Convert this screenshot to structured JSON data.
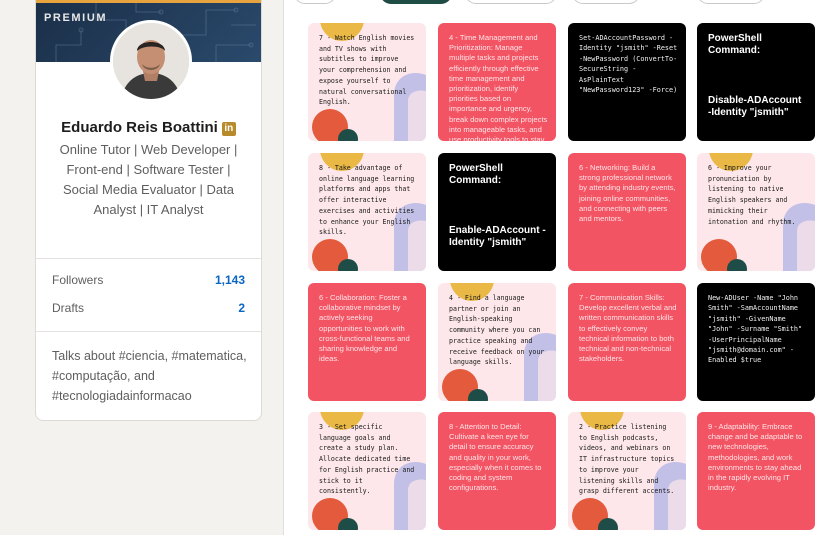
{
  "profile": {
    "badge": "PREMIUM",
    "name": "Eduardo Reis Boattini",
    "linkedin_badge": "in",
    "headline": "Online Tutor | Web Developer | Front-end | Software Tester | Social Media Evaluator | Data Analyst | IT Analyst",
    "stats": {
      "followers_label": "Followers",
      "followers_value": "1,143",
      "drafts_label": "Drafts",
      "drafts_value": "2"
    },
    "talks_about": "Talks about #ciencia, #matematica, #computação, and #tecnologiadainformacao"
  },
  "colors": {
    "accent_link": "#0a66c2",
    "tile_pink": "#fde7ea",
    "tile_red": "#f25464",
    "tile_black": "#000000",
    "deco_yellow": "#e9b845",
    "deco_lavender": "#b7b9e6",
    "deco_teal": "#1e4d47",
    "deco_orange": "#e35a3c"
  },
  "tiles": [
    {
      "style": "pink",
      "text": "7 - Watch English movies and TV shows with subtitles to improve your comprehension and expose yourself to natural conversational English."
    },
    {
      "style": "red",
      "text": "4 - Time Management and Prioritization: Manage multiple tasks and projects efficiently through effective time management and prioritization, identify priorities based on importance and urgency, break down complex projects into manageable tasks, and use productivity tools to stay organized."
    },
    {
      "style": "black-code",
      "text": "Set-ADAccountPassword -Identity \"jsmith\" -Reset -NewPassword (ConvertTo-SecureString -AsPlainText \"NewPassword123\" -Force)"
    },
    {
      "style": "black-ps",
      "title": "PowerShell Command:",
      "cmd": "Disable-ADAccount -Identity \"jsmith\""
    },
    {
      "style": "pink",
      "text": "8 - Take advantage of online language learning platforms and apps that offer interactive exercises and activities to enhance your English skills."
    },
    {
      "style": "black-ps",
      "title": "PowerShell Command:",
      "cmd": "Enable-ADAccount -Identity \"jsmith\""
    },
    {
      "style": "red",
      "text": "6 - Networking: Build a strong professional network by attending industry events, joining online communities, and connecting with peers and mentors."
    },
    {
      "style": "pink",
      "text": "6 - Improve your pronunciation by listening to native English speakers and mimicking their intonation and rhythm."
    },
    {
      "style": "red",
      "text": "6 - Collaboration: Foster a collaborative mindset by actively seeking opportunities to work with cross-functional teams and sharing knowledge and ideas."
    },
    {
      "style": "pink",
      "text": "4 - Find a language partner or join an English-speaking community where you can practice speaking and receive feedback on your language skills."
    },
    {
      "style": "red",
      "text": "7 - Communication Skills: Develop excellent verbal and written communication skills to effectively convey technical information to both technical and non-technical stakeholders."
    },
    {
      "style": "black-code",
      "text": "New-ADUser -Name \"John Smith\" -SamAccountName \"jsmith\" -GivenName \"John\" -Surname \"Smith\" -UserPrincipalName \"jsmith@domain.com\" -Enabled $true"
    },
    {
      "style": "pink",
      "text": "3 - Set specific language goals and create a study plan. Allocate dedicated time for English practice and stick to it consistently."
    },
    {
      "style": "red",
      "text": "8 - Attention to Detail: Cultivate a keen eye for detail to ensure accuracy and quality in your work, especially when it comes to coding and system configurations."
    },
    {
      "style": "pink",
      "text": "2 - Practice listening to English podcasts, videos, and webinars on IT infrastructure topics to improve your listening skills and grasp different accents."
    },
    {
      "style": "red",
      "text": "9 - Adaptability: Embrace change and be adaptable to new technologies, methodologies, and work environments to stay ahead in the rapidly evolving IT industry."
    }
  ]
}
